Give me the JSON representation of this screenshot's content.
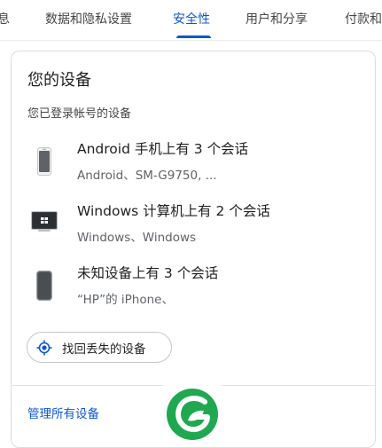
{
  "tabs": [
    {
      "label": "息"
    },
    {
      "label": "数据和隐私设置"
    },
    {
      "label": "安全性"
    },
    {
      "label": "用户和分享"
    },
    {
      "label": "付款和"
    }
  ],
  "accent_color": "#0b57d0",
  "card": {
    "title": "您的设备",
    "subtitle": "您已登录帐号的设备",
    "devices": [
      {
        "name": "Android 手机上有 3 个会话",
        "detail": "Android、SM-G9750, ...",
        "icon": "android-phone-icon"
      },
      {
        "name": "Windows 计算机上有 2 个会话",
        "detail": "Windows、Windows",
        "icon": "windows-computer-icon"
      },
      {
        "name": "未知设备上有 3 个会话",
        "detail": "“HP”的 iPhone、",
        "icon": "unknown-phone-icon"
      }
    ],
    "find_device_button": "找回丢失的设备",
    "manage_link": "管理所有设备"
  }
}
